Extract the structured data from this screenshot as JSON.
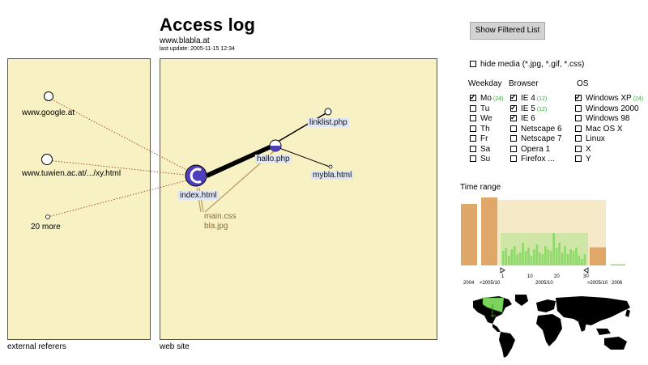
{
  "header": {
    "title": "Access log",
    "site": "www.blabla.at",
    "last_update": "last update: 2005-11-15  12:34"
  },
  "filter_button": {
    "label": "Show Filtered List"
  },
  "panels": {
    "referers_caption": "external referers",
    "website_caption": "web site"
  },
  "referers": [
    "www.google.at",
    "www.tuwien.ac.at/.../xy.html",
    "20 more"
  ],
  "pages": {
    "index": "index.html",
    "hallo": "hallo.php",
    "linklist": "linklist.php",
    "mybla": "mybla.html",
    "resources": [
      "main.css",
      "bla.jpg"
    ]
  },
  "hide_media": {
    "label": "hide media (*.jpg, *.gif, *.css)",
    "checked": false
  },
  "weekday": {
    "header": "Weekday",
    "items": [
      {
        "label": "Mo",
        "checked": true,
        "count": "(24)"
      },
      {
        "label": "Tu",
        "checked": false,
        "count": ""
      },
      {
        "label": "We",
        "checked": false,
        "count": ""
      },
      {
        "label": "Th",
        "checked": false,
        "count": ""
      },
      {
        "label": "Fr",
        "checked": false,
        "count": ""
      },
      {
        "label": "Sa",
        "checked": false,
        "count": ""
      },
      {
        "label": "Su",
        "checked": false,
        "count": ""
      }
    ]
  },
  "browser": {
    "header": "Browser",
    "items": [
      {
        "label": "IE 4",
        "checked": true,
        "count": "(12)"
      },
      {
        "label": "IE 5",
        "checked": true,
        "count": "(12)"
      },
      {
        "label": "IE 6",
        "checked": true,
        "count": ""
      },
      {
        "label": "Netscape 6",
        "checked": false,
        "count": ""
      },
      {
        "label": "Netscape 7",
        "checked": false,
        "count": ""
      },
      {
        "label": "Opera 1",
        "checked": false,
        "count": ""
      },
      {
        "label": "Firefox ...",
        "checked": false,
        "count": ""
      }
    ]
  },
  "os": {
    "header": "OS",
    "items": [
      {
        "label": "Windows XP",
        "checked": true,
        "count": "(24)"
      },
      {
        "label": "Windows 2000",
        "checked": false,
        "count": ""
      },
      {
        "label": "Windows 98",
        "checked": false,
        "count": ""
      },
      {
        "label": "Mac OS X",
        "checked": false,
        "count": ""
      },
      {
        "label": "Linux",
        "checked": false,
        "count": ""
      },
      {
        "label": "X",
        "checked": false,
        "count": ""
      },
      {
        "label": "Y",
        "checked": false,
        "count": ""
      }
    ]
  },
  "time_range": {
    "title": "Time range",
    "labels": {
      "y2004": "2004",
      "before": "<2005/10",
      "day1": "1",
      "day10": "10",
      "day20": "20",
      "day30": "30",
      "month": "2005/10",
      "after": ">2005/10",
      "y2006": "2006"
    },
    "colors": {
      "orange": "#e0a868",
      "green": "#8ed96a",
      "range_bg": "#f5e9c7"
    }
  },
  "chart_data": {
    "type": "bar",
    "categories": [
      "2004",
      "<2005/10",
      "2005/10 days 1-30",
      ">2005/10",
      "2006"
    ],
    "daily_values": [
      0.45,
      0.55,
      0.3,
      0.5,
      0.6,
      0.35,
      0.4,
      0.7,
      0.45,
      0.55,
      0.3,
      0.5,
      0.65,
      0.4,
      0.35,
      0.6,
      0.5,
      0.45,
      1.0,
      0.55,
      0.7,
      0.4,
      0.6,
      0.35,
      0.5,
      0.45,
      0.55,
      0.3,
      0.2,
      0.35
    ],
    "totals": {
      "2004": 1.0,
      "<2005/10": 1.05,
      ">2005/10": 0.28,
      "2006": 0.02
    }
  }
}
